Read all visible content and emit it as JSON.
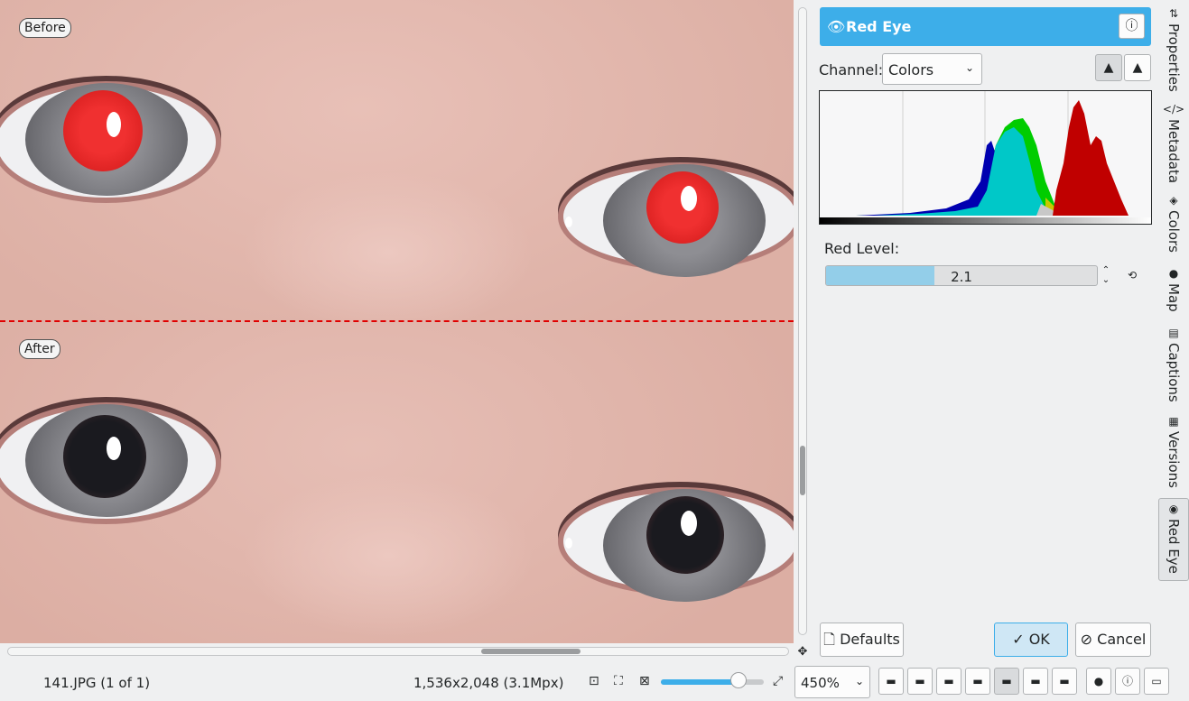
{
  "preview": {
    "before_label": "Before",
    "after_label": "After"
  },
  "tool": {
    "title": "Red Eye",
    "title_icon": "eye-icon",
    "info_icon": "info-icon",
    "channel_label": "Channel:",
    "channel_value": "Colors",
    "linear_histogram_icon": "linear-histogram-icon",
    "log_histogram_icon": "log-histogram-icon",
    "red_level_label": "Red Level:",
    "red_level_value": "2.1",
    "red_level_fraction": 0.4,
    "reset_icon": "reset-icon"
  },
  "buttons": {
    "defaults": "Defaults",
    "ok": "OK",
    "cancel": "Cancel"
  },
  "sidebar_tabs": [
    {
      "label": "Properties",
      "icon": "properties-icon"
    },
    {
      "label": "Metadata",
      "icon": "metadata-icon"
    },
    {
      "label": "Colors",
      "icon": "colors-icon"
    },
    {
      "label": "Map",
      "icon": "map-icon"
    },
    {
      "label": "Captions",
      "icon": "captions-icon"
    },
    {
      "label": "Versions",
      "icon": "versions-icon"
    },
    {
      "label": "Red Eye",
      "icon": "red-eye-icon"
    }
  ],
  "status": {
    "filename": "141.JPG (1 of 1)",
    "dimensions": "1,536x2,048 (3.1Mpx)",
    "zoom": "450%",
    "zoom_fraction": 0.75
  },
  "colors": {
    "accent": "#3daee9",
    "divider": "#e00000",
    "histogram_red": "#c00000",
    "histogram_green": "#00cc00",
    "histogram_blue": "#0000b0",
    "histogram_cyan": "#00c8c8"
  }
}
